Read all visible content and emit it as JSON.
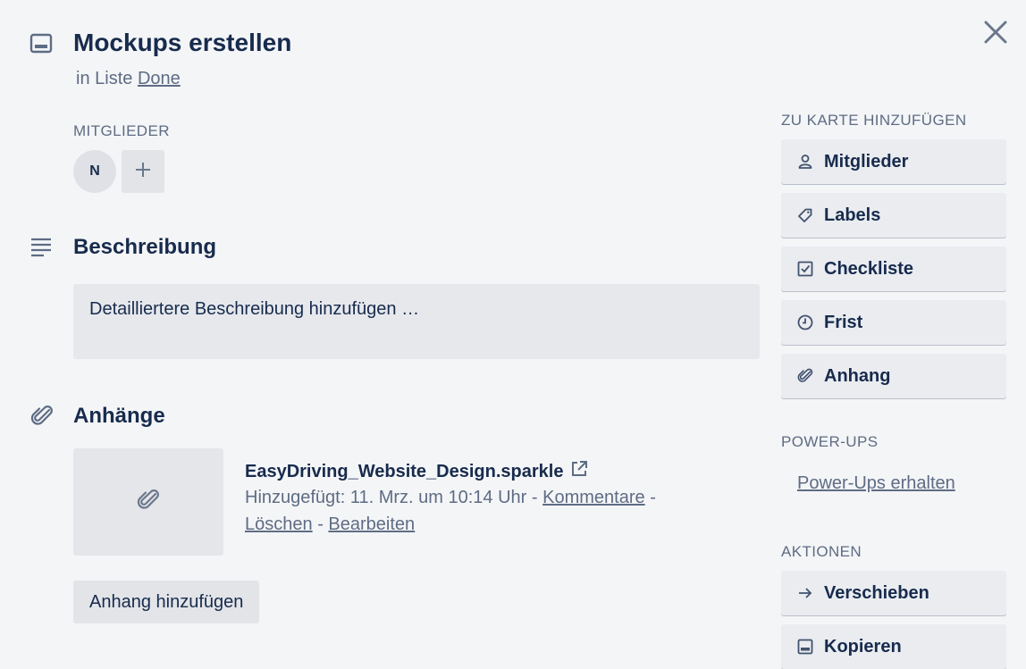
{
  "card": {
    "title": "Mockups erstellen",
    "list_prefix": "in Liste",
    "list_name": "Done"
  },
  "icons": {
    "card": "card-icon",
    "close": "close-icon",
    "description": "description-lines-icon",
    "attachments": "paperclip-icon",
    "external_link": "external-link-icon"
  },
  "members": {
    "label": "MITGLIEDER",
    "avatar_initial": "N"
  },
  "description": {
    "title": "Beschreibung",
    "placeholder": "Detailliertere Beschreibung hinzufügen …"
  },
  "attachments": {
    "title": "Anhänge",
    "items": [
      {
        "name": "EasyDriving_Website_Design.sparkle",
        "added_prefix": "Hinzugefügt: 11. Mrz. um 10:14 Uhr",
        "separator": "-",
        "comments_label": "Kommentare",
        "delete_label": "Löschen",
        "edit_label": "Bearbeiten"
      }
    ],
    "add_button": "Anhang hinzufügen"
  },
  "sidebar": {
    "add_to_card_label": "ZU KARTE HINZUFÜGEN",
    "add_items": [
      {
        "label": "Mitglieder",
        "icon": "person-icon"
      },
      {
        "label": "Labels",
        "icon": "tag-icon"
      },
      {
        "label": "Checkliste",
        "icon": "checkbox-icon"
      },
      {
        "label": "Frist",
        "icon": "clock-icon"
      },
      {
        "label": "Anhang",
        "icon": "paperclip-icon"
      }
    ],
    "powerups_label": "POWER-UPS",
    "powerups_link": "Power-Ups erhalten",
    "actions_label": "AKTIONEN",
    "action_items": [
      {
        "label": "Verschieben",
        "icon": "arrow-right-icon"
      },
      {
        "label": "Kopieren",
        "icon": "copy-card-icon"
      }
    ]
  },
  "colors": {
    "background": "#f4f5f7",
    "text": "#172b4d",
    "muted": "#5e6c84",
    "button": "#eaecf0"
  }
}
